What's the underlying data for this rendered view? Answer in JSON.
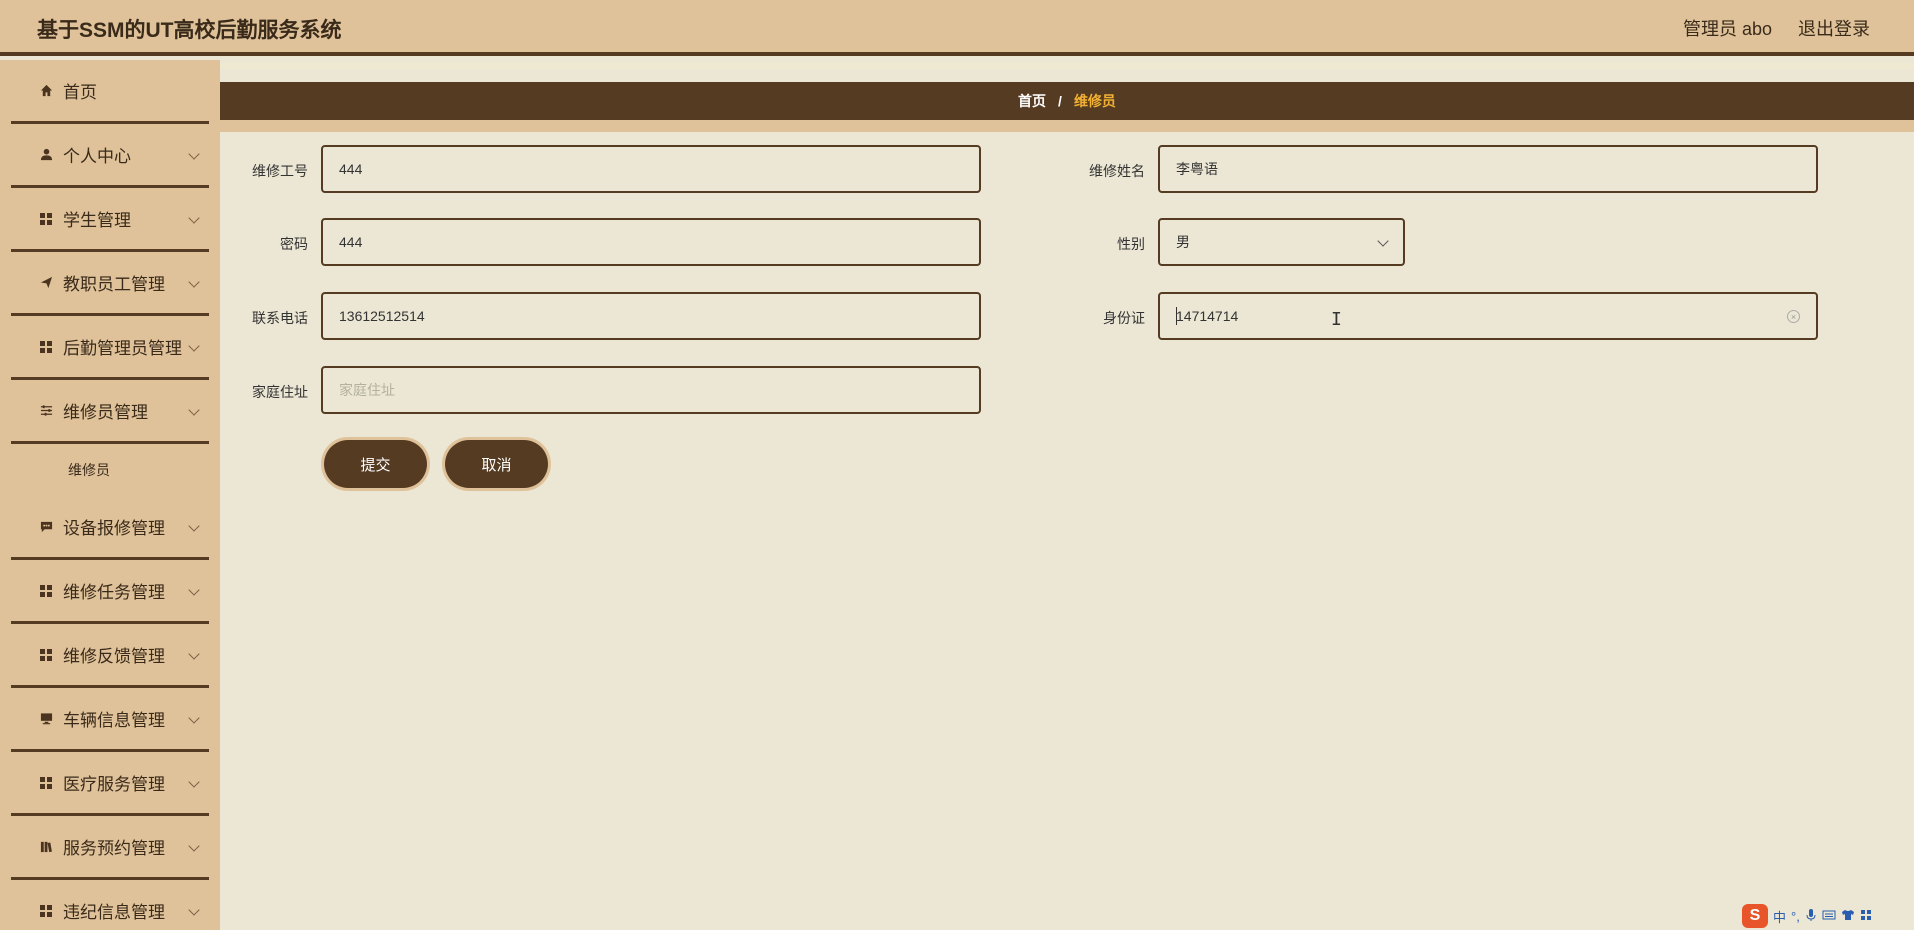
{
  "header": {
    "title": "基于SSM的UT高校后勤服务系统",
    "user": "管理员 abo",
    "logout": "退出登录"
  },
  "sidebar": {
    "items": [
      {
        "label": "首页",
        "icon": "home-icon"
      },
      {
        "label": "个人中心",
        "icon": "user-icon"
      },
      {
        "label": "学生管理",
        "icon": "grid-icon"
      },
      {
        "label": "教职员工管理",
        "icon": "send-icon"
      },
      {
        "label": "后勤管理员管理",
        "icon": "grid-icon"
      },
      {
        "label": "维修员管理",
        "icon": "sliders-icon",
        "sub": "维修员"
      },
      {
        "label": "设备报修管理",
        "icon": "chat-icon"
      },
      {
        "label": "维修任务管理",
        "icon": "grid-icon"
      },
      {
        "label": "维修反馈管理",
        "icon": "grid-icon"
      },
      {
        "label": "车辆信息管理",
        "icon": "monitor-icon"
      },
      {
        "label": "医疗服务管理",
        "icon": "grid-icon"
      },
      {
        "label": "服务预约管理",
        "icon": "book-icon"
      },
      {
        "label": "违纪信息管理",
        "icon": "grid-icon"
      }
    ]
  },
  "breadcrumb": {
    "home": "首页",
    "separator": "/",
    "current": "维修员"
  },
  "form": {
    "repair_id": {
      "label": "维修工号",
      "value": "444"
    },
    "repair_name": {
      "label": "维修姓名",
      "value": "李粤语"
    },
    "password": {
      "label": "密码",
      "value": "444"
    },
    "gender": {
      "label": "性别",
      "value": "男"
    },
    "phone": {
      "label": "联系电话",
      "value": "13612512514"
    },
    "id_card": {
      "label": "身份证",
      "value": "14714714"
    },
    "address": {
      "label": "家庭住址",
      "placeholder": "家庭住址"
    },
    "submit": "提交",
    "cancel": "取消"
  },
  "ime": {
    "logo": "S",
    "lang": "中",
    "punct": "°,"
  },
  "colors": {
    "header_bg": "#dfc29a",
    "accent_dark": "#553b22",
    "page_bg": "#ebe7d4",
    "breadcrumb_current": "#f2b133"
  }
}
